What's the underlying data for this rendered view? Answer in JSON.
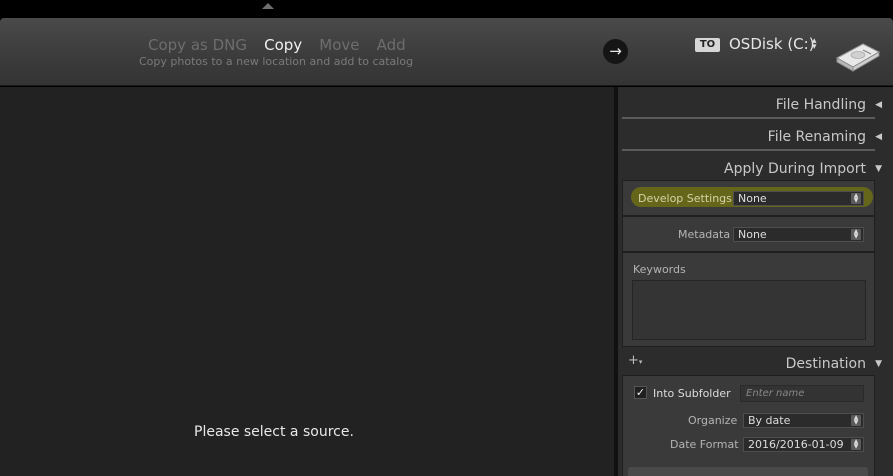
{
  "header": {
    "modes": [
      {
        "label": "Copy as DNG",
        "active": false
      },
      {
        "label": "Copy",
        "active": true
      },
      {
        "label": "Move",
        "active": false
      },
      {
        "label": "Add",
        "active": false
      }
    ],
    "mode_description": "Copy photos to a new location and add to catalog",
    "go_icon": "arrow-right-icon",
    "destination_badge": "TO",
    "destination_disk": "OSDisk (C:)",
    "disk_icon": "hard-disk-icon"
  },
  "main": {
    "empty_message": "Please select a source."
  },
  "panel": {
    "file_handling": {
      "title": "File Handling",
      "icon": "triangle-left-icon"
    },
    "file_renaming": {
      "title": "File Renaming",
      "icon": "triangle-left-icon"
    },
    "apply_during_import": {
      "title": "Apply During Import",
      "icon": "triangle-down-icon",
      "develop_settings_label": "Develop Settings",
      "develop_settings_value": "None",
      "develop_settings_highlight": "#8a8a00",
      "metadata_label": "Metadata",
      "metadata_value": "None",
      "keywords_label": "Keywords",
      "keywords_value": ""
    },
    "destination": {
      "title": "Destination",
      "icon": "triangle-down-icon",
      "add_icon": "plus-icon",
      "into_subfolder_label": "Into Subfolder",
      "into_subfolder_checked": true,
      "subfolder_placeholder": "Enter name",
      "organize_label": "Organize",
      "organize_value": "By date",
      "date_format_label": "Date Format",
      "date_format_value": "2016/2016-01-09"
    }
  }
}
